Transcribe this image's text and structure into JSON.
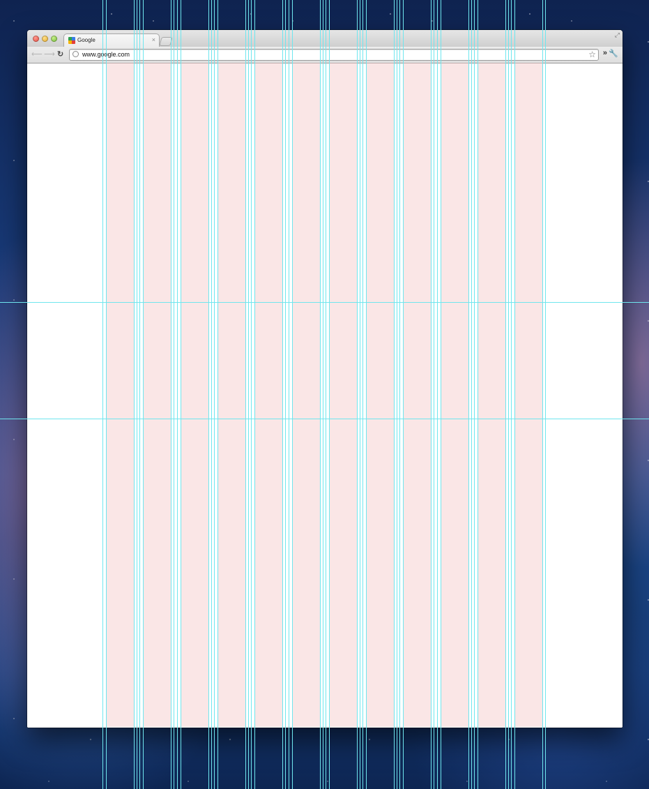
{
  "browser": {
    "tab_title": "Google",
    "tab_close_glyph": "×",
    "url": "www.google.com",
    "icons": {
      "back": "back-arrow-icon",
      "forward": "forward-arrow-icon",
      "reload": "reload-icon",
      "globe": "globe-icon",
      "bookmark": "star-icon",
      "overflow": "chevron-right-icon",
      "settings": "wrench-icon",
      "fullscreen": "fullscreen-icon"
    }
  },
  "grid_overlay": {
    "column_count": 12,
    "column_color": "#f8dcdc",
    "guide_color": "#6fe6ee"
  }
}
